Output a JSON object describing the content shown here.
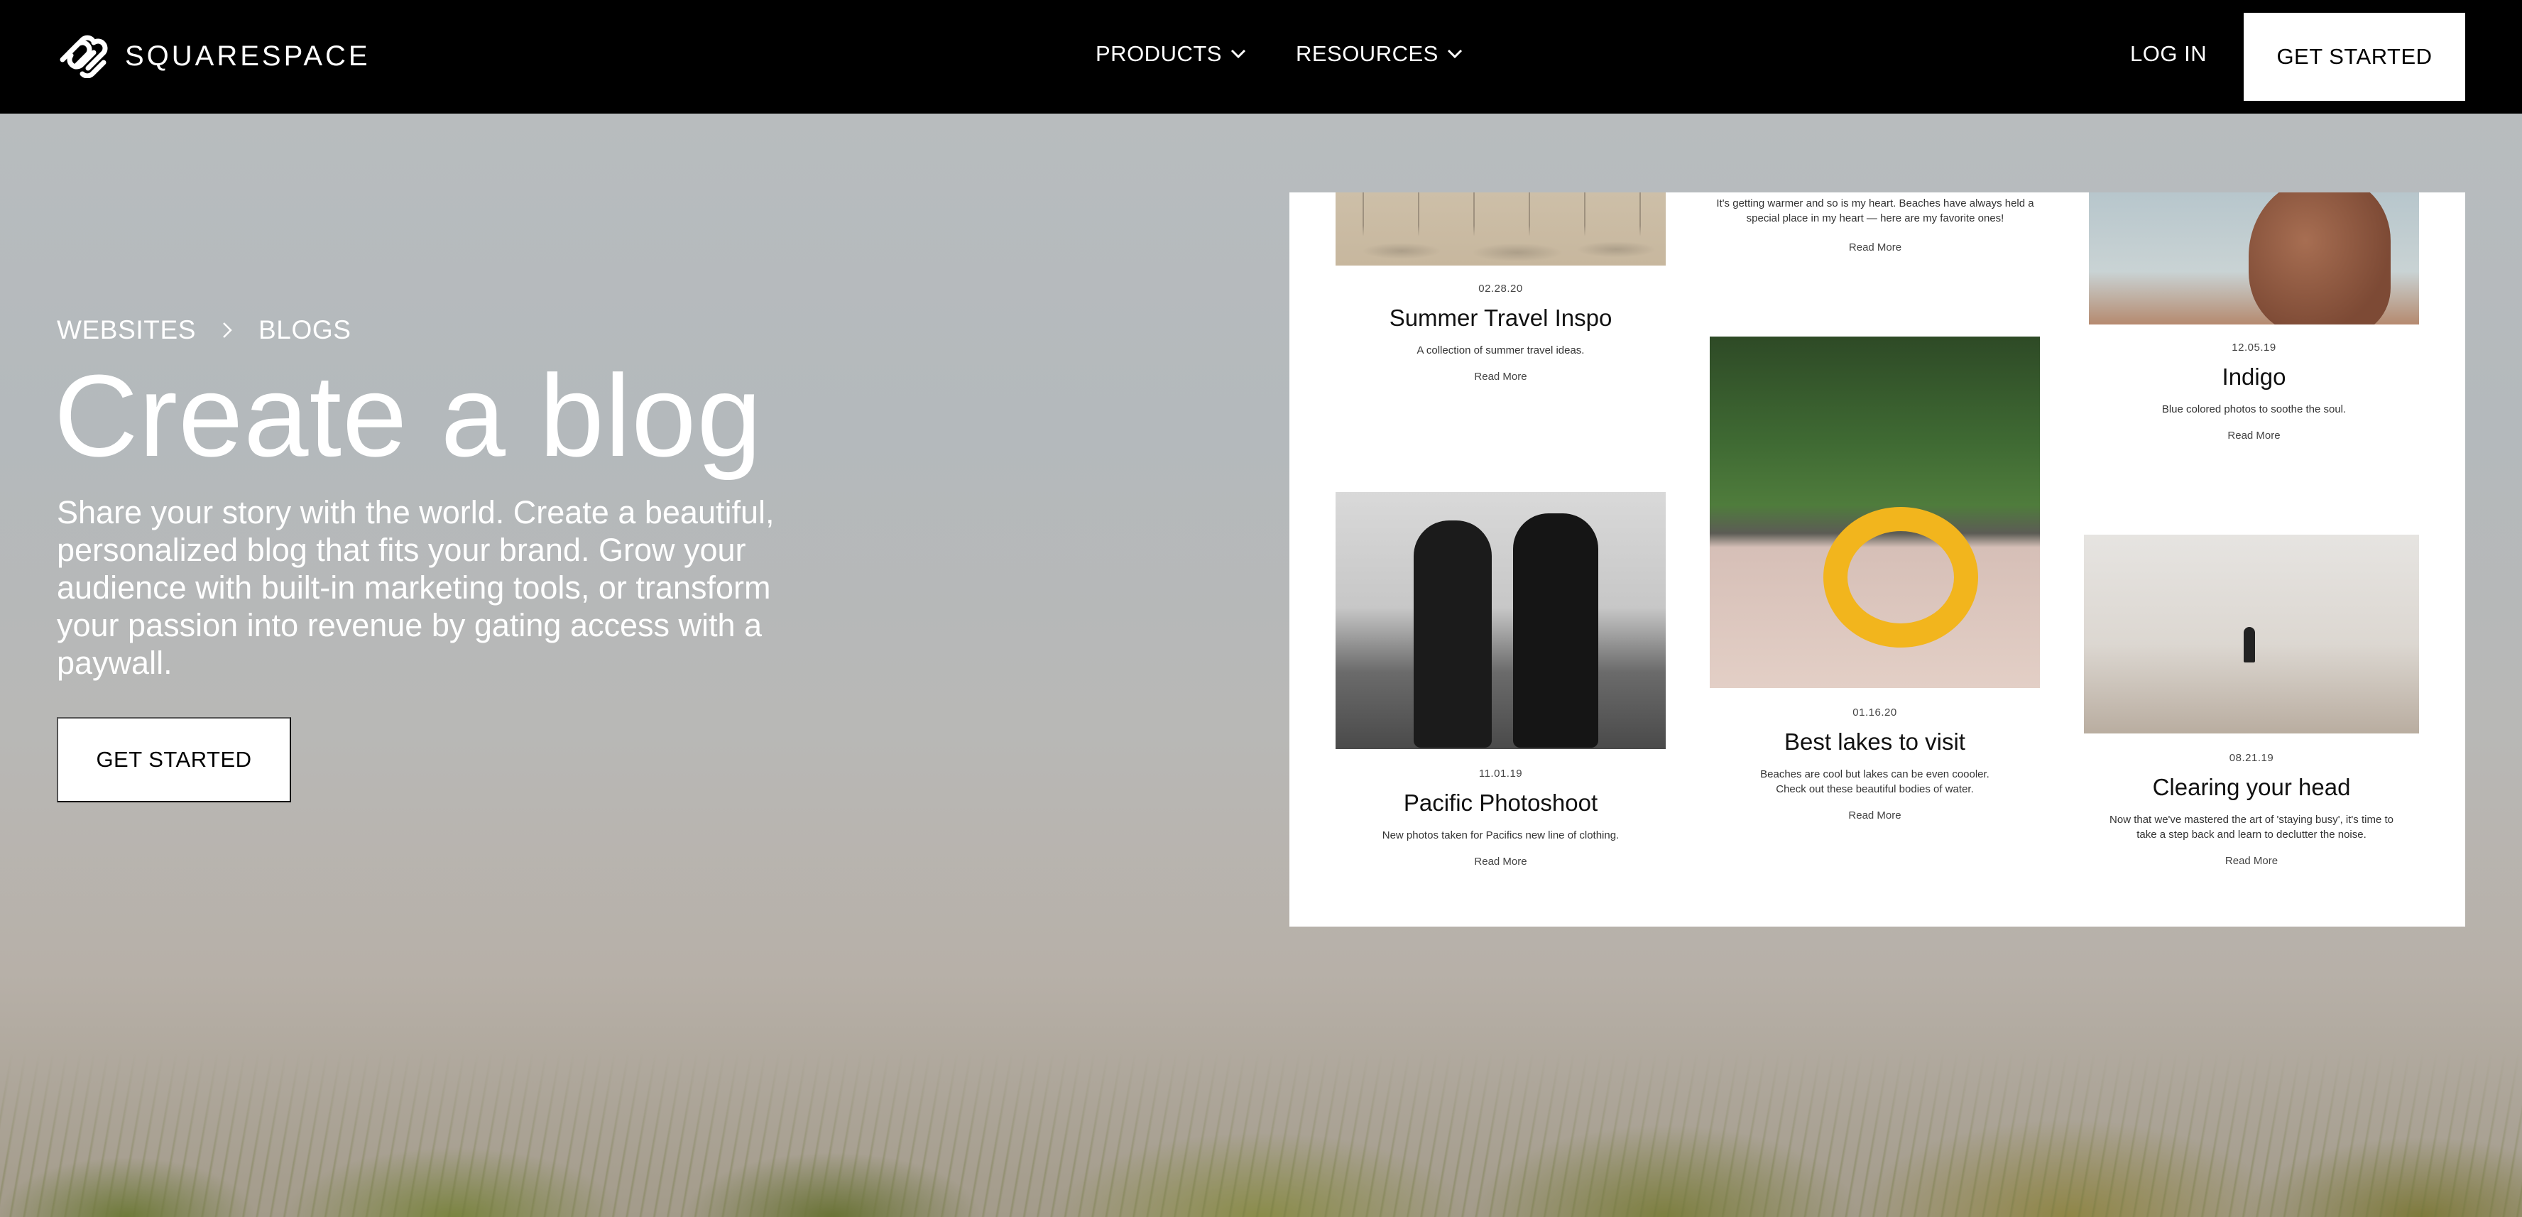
{
  "nav": {
    "logo_text": "SQUARESPACE",
    "menu": [
      {
        "label": "PRODUCTS"
      },
      {
        "label": "RESOURCES"
      }
    ],
    "login_label": "LOG IN",
    "cta_label": "GET STARTED"
  },
  "breadcrumb": [
    "WEBSITES",
    "BLOGS"
  ],
  "hero": {
    "title": "Create a blog",
    "description": "Share your story with the world. Create a beautiful, personalized blog that fits your brand. Grow your audience with built-in marketing tools, or transform your passion into revenue by gating access with a paywall.",
    "cta_label": "GET STARTED"
  },
  "preview": {
    "posts": [
      {
        "date": "02.28.20",
        "title": "Summer Travel Inspo",
        "desc": "A collection of summer travel ideas.",
        "more": "Read More"
      },
      {
        "date": "",
        "title": "",
        "desc": "It's getting warmer and so is my heart. Beaches have always held a special place in my heart — here are my favorite ones!",
        "more": "Read More"
      },
      {
        "date": "12.05.19",
        "title": "Indigo",
        "desc": "Blue colored photos to soothe the soul.",
        "more": "Read More"
      },
      {
        "date": "11.01.19",
        "title": "Pacific Photoshoot",
        "desc": "New photos taken for Pacifics new line of clothing.",
        "more": "Read More"
      },
      {
        "date": "01.16.20",
        "title": "Best lakes to visit",
        "desc": "Beaches are cool but lakes can be even coooler. Check out these beautiful bodies of water.",
        "more": "Read More"
      },
      {
        "date": "08.21.19",
        "title": "Clearing your head",
        "desc": "Now that we've mastered the art of 'staying busy', it's time to take a step back and learn to declutter the noise.",
        "more": "Read More"
      }
    ]
  },
  "colors": {
    "nav_bg": "#000000",
    "cta_bg": "#ffffff",
    "text_light": "#ffffff"
  }
}
